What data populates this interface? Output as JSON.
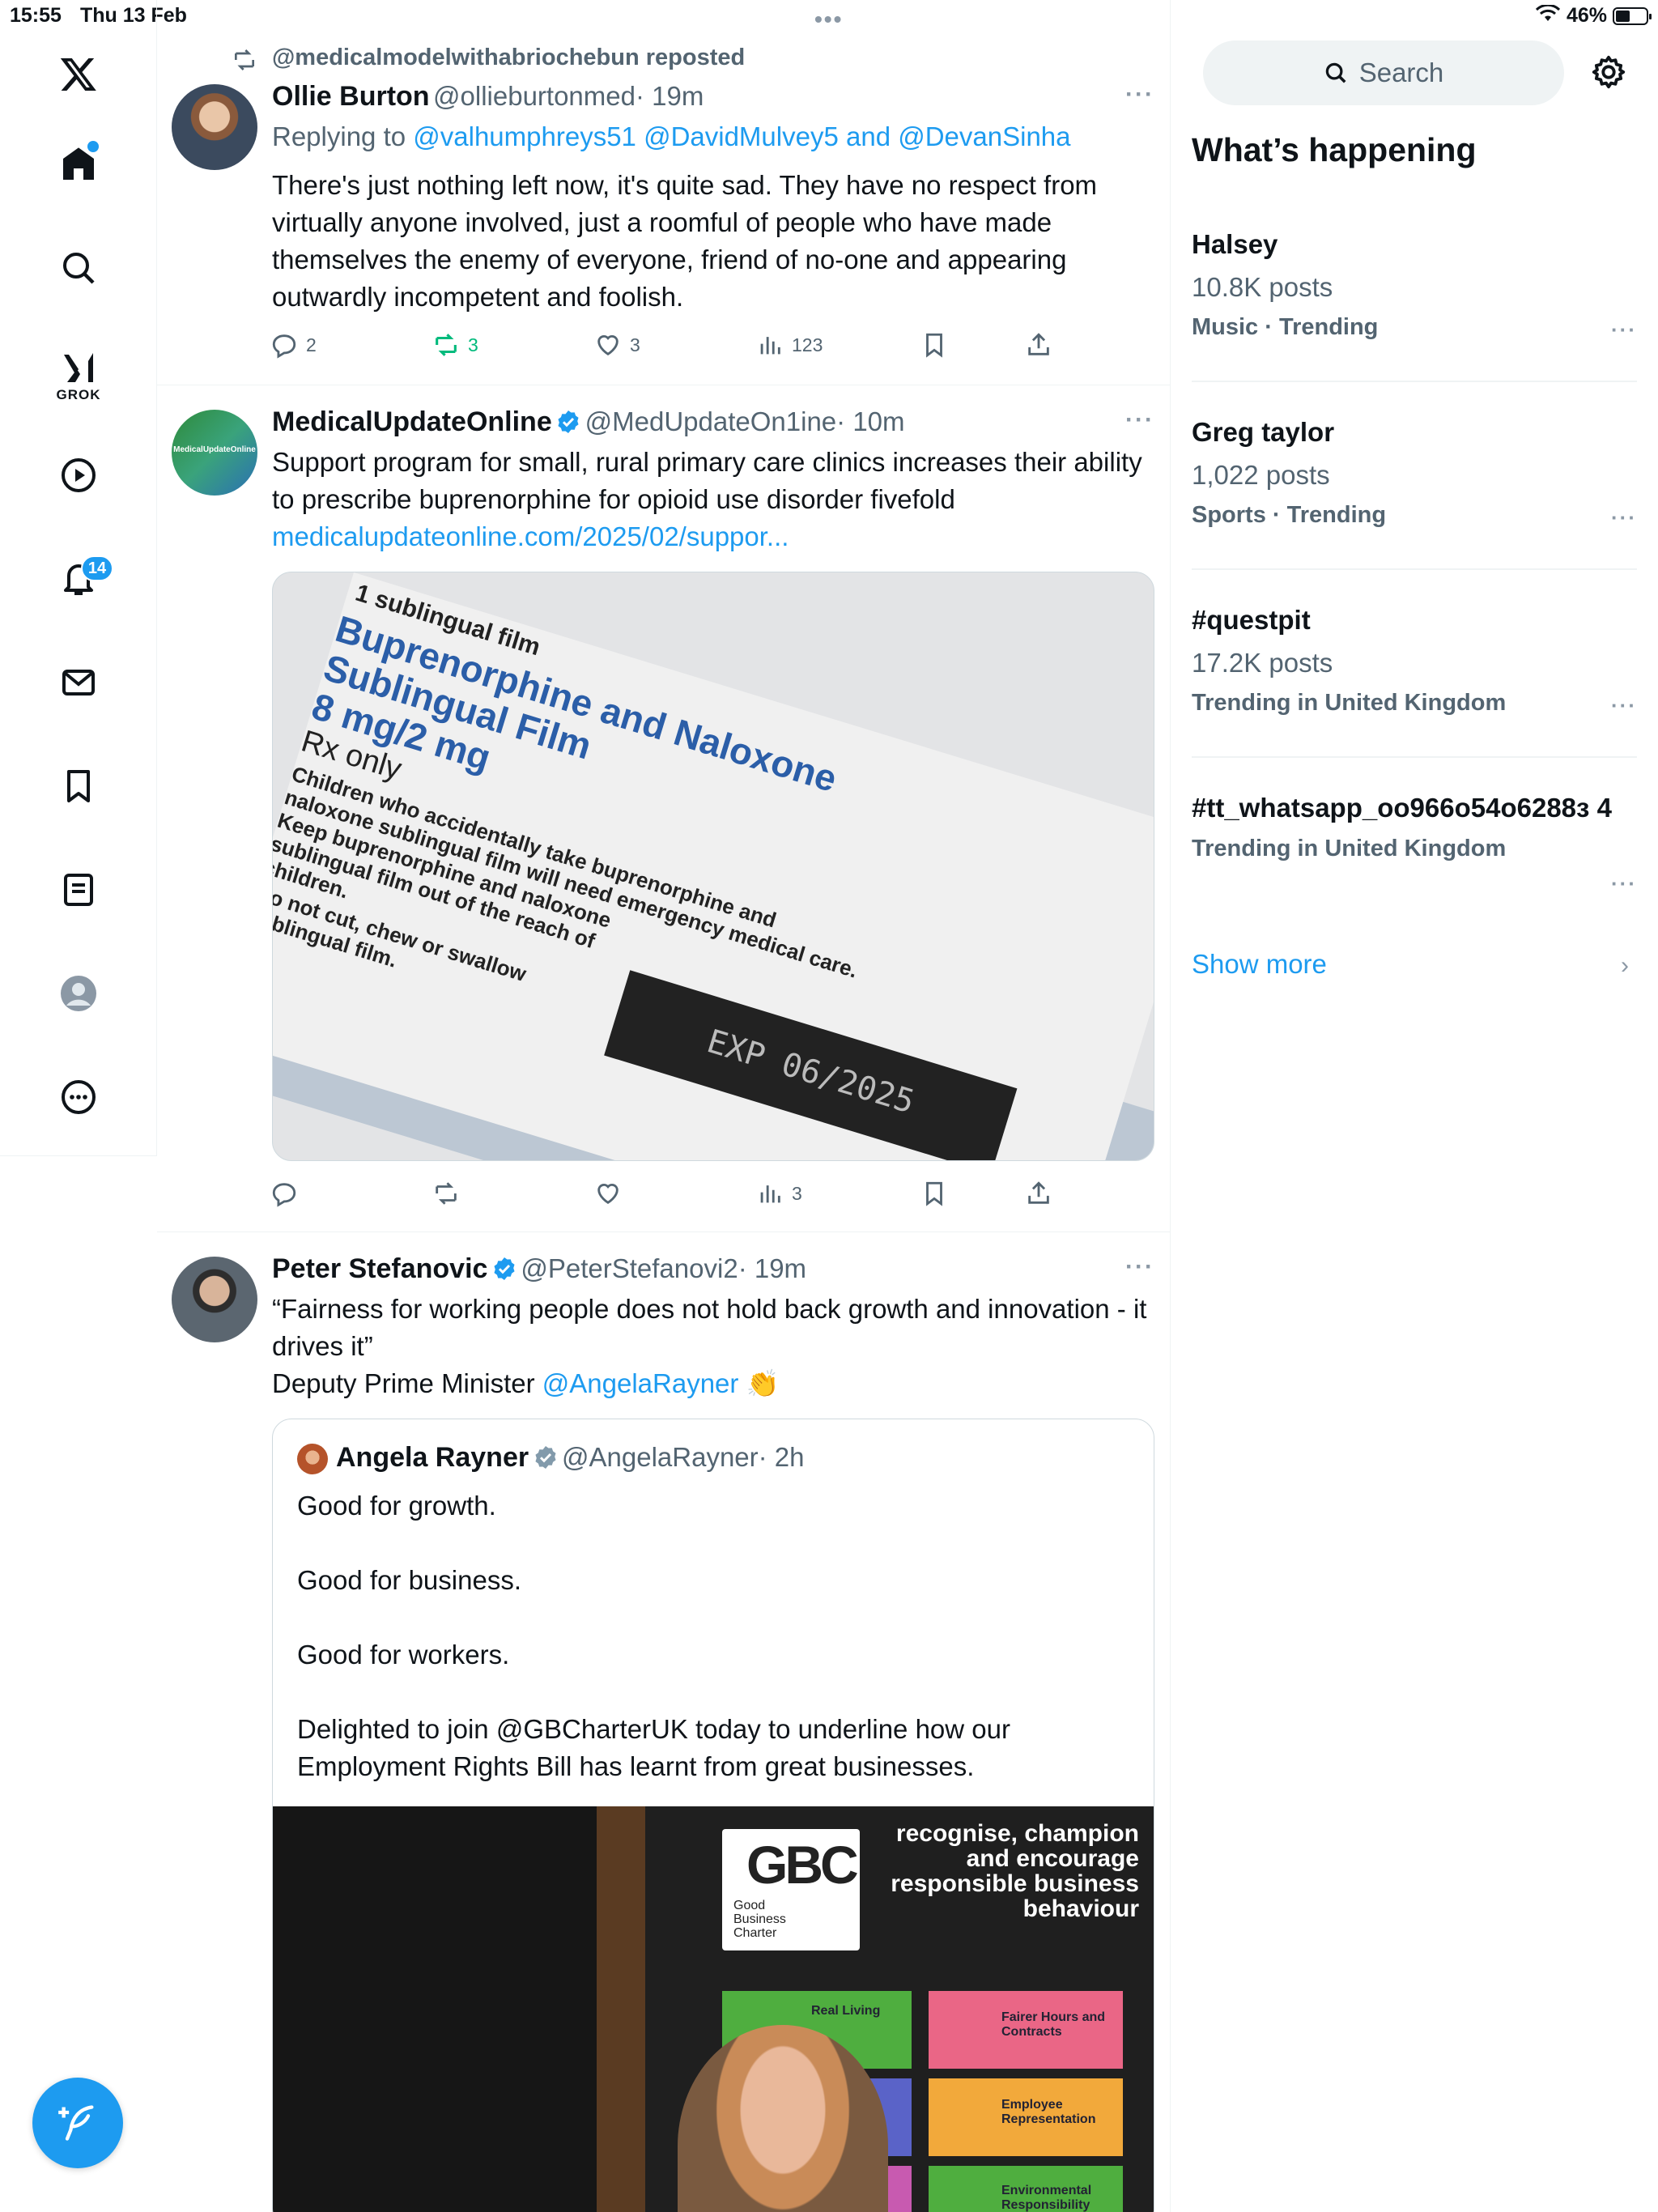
{
  "status_bar": {
    "time": "15:55",
    "date": "Thu 13 Feb",
    "battery": "46%"
  },
  "nav": {
    "grok_label": "GROK",
    "notification_count": "14",
    "icons": [
      "x-logo-icon",
      "home-icon",
      "search-icon",
      "grok-icon",
      "video-icon",
      "notifications-icon",
      "messages-icon",
      "bookmarks-icon",
      "lists-icon",
      "profile-icon",
      "more-icon",
      "compose-icon"
    ]
  },
  "posts": [
    {
      "repost_label": "@medicalmodelwithabriochebun reposted",
      "name": "Ollie Burton",
      "handle": "@ollieburtonmed",
      "time": "· 19m",
      "replying_prefix": "Replying to ",
      "replying_to": "@valhumphreys51 @DavidMulvey5 and @DevanSinha",
      "text": "There's just nothing left now, it's quite sad. They have no respect from virtually anyone involved, just a roomful of people who have made themselves the enemy of everyone, friend of no-one and appearing outwardly incompetent and foolish.",
      "replies": "2",
      "reposts": "3",
      "likes": "3",
      "views": "123"
    },
    {
      "name": "MedicalUpdateOnline",
      "handle": "@MedUpdateOn1ine",
      "time": "· 10m",
      "avatar_text": "MedicalUpdateOnline",
      "text": "Support program for small, rural primary care clinics increases their ability to prescribe buprenorphine for opioid use disorder fivefold",
      "link": "medicalupdateonline.com/2025/02/suppor...",
      "image": {
        "line1": "1 sublingual film",
        "line2": "Buprenorphine and Naloxone",
        "line3": "Sublingual Film",
        "line4": "8 mg/2 mg",
        "line5": "Rx only",
        "warn1": "Children who accidentally take buprenorphine and",
        "warn2": "naloxone sublingual film will need emergency medical care.",
        "warn3": "Keep buprenorphine and naloxone",
        "warn4": "sublingual film out of the reach of",
        "warn5": "children.",
        "warn6": "Do not cut, chew or swallow",
        "warn7": "sublingual film.",
        "exp": "EXP 06/2025"
      },
      "views": "3"
    },
    {
      "name": "Peter Stefanovic",
      "handle": "@PeterStefanovi2",
      "time": "· 19m",
      "text_line1": "“Fairness for working people does not hold back growth and innovation - it drives it”",
      "text_line2_prefix": "Deputy Prime Minister ",
      "mention": "@AngelaRayner",
      "emoji": "👏",
      "quote": {
        "name": "Angela Rayner",
        "handle": "@AngelaRayner",
        "time": "· 2h",
        "lines": [
          "Good for growth.",
          "Good for business.",
          "Good for workers.",
          "Delighted to join @GBCharterUK today to underline how our Employment Rights Bill has learnt from great businesses."
        ],
        "video": {
          "logo": "GBC",
          "logo_sub": "Good Business Charter",
          "slogan": "recognise, champion and encourage responsible business behaviour",
          "tile1": "Real Living",
          "tile2": "Fairer Hours and Contracts",
          "tile3": "Employee Representation",
          "tile4": "Environmental Responsibility"
        }
      }
    }
  ],
  "sidebar": {
    "search_placeholder": "Search",
    "title": "What’s happening",
    "trends": [
      {
        "title": "Halsey",
        "count": "10.8K posts",
        "category": "Music · Trending"
      },
      {
        "title": "Greg taylor",
        "count": "1,022 posts",
        "category": "Sports · Trending"
      },
      {
        "title": "#questpit",
        "count": "17.2K posts",
        "category": "Trending in United Kingdom"
      },
      {
        "title": "#tt_whatsapp_oo966o54o6288з 4",
        "count": "",
        "category": "Trending in United Kingdom"
      }
    ],
    "show_more": "Show more"
  }
}
